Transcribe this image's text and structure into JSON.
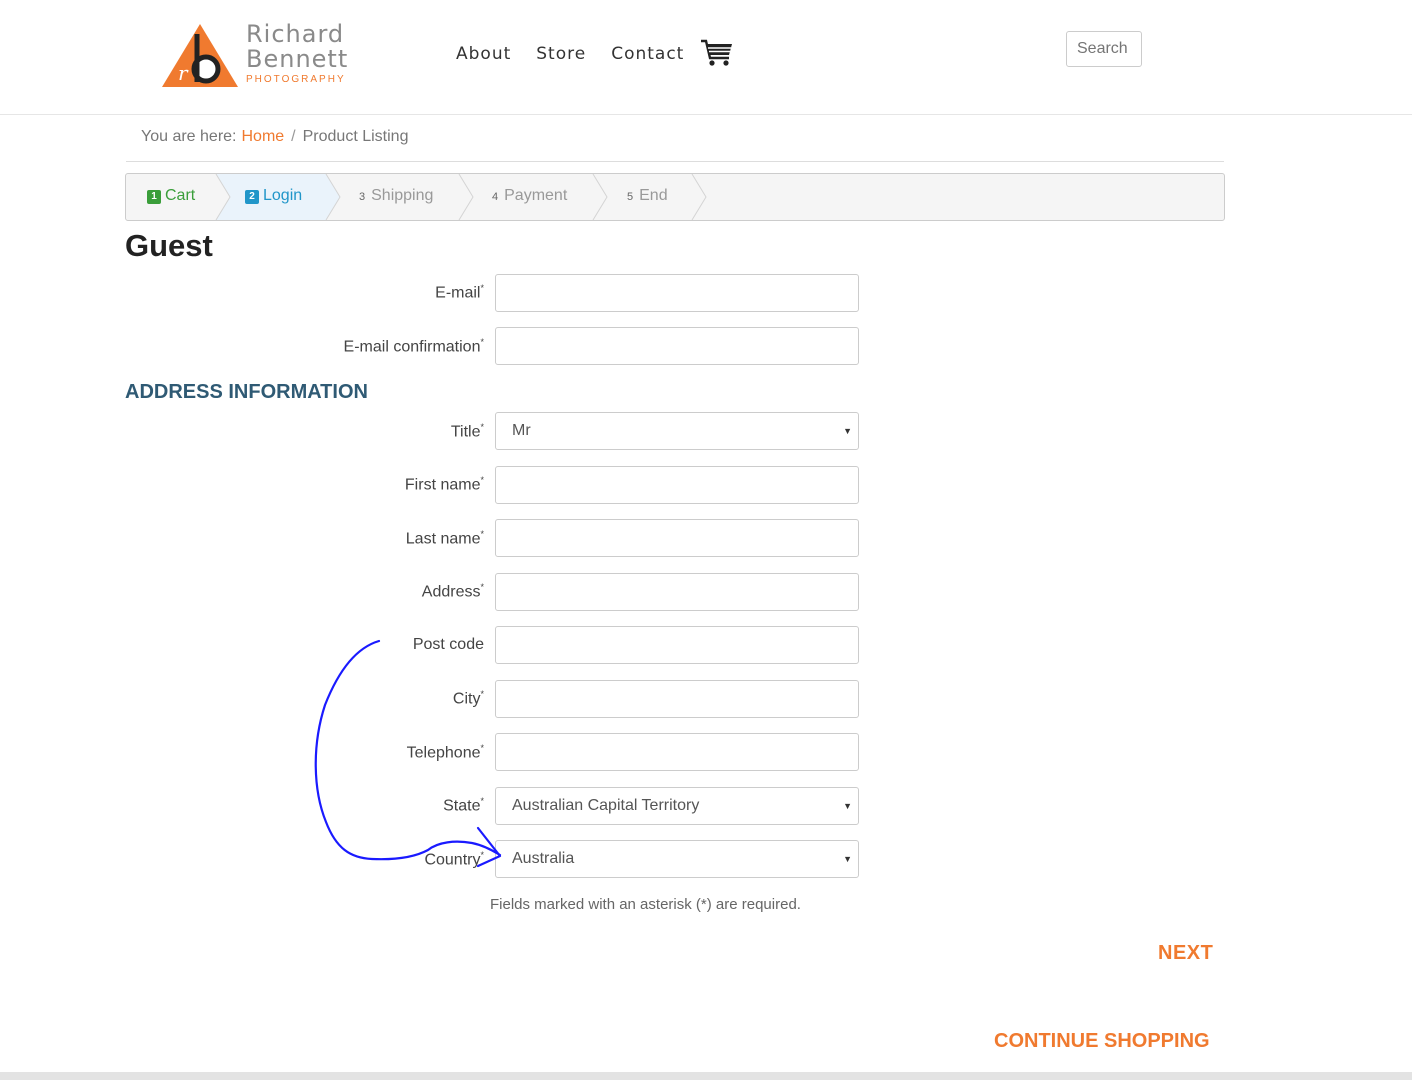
{
  "brand": {
    "line1": "Richard",
    "line2": "Bennett",
    "line3": "PHOTOGRAPHY",
    "accent": "#f07a2f"
  },
  "nav": {
    "items": [
      "About",
      "Store",
      "Contact"
    ],
    "cart_icon": "cart-icon"
  },
  "search": {
    "placeholder": "Search"
  },
  "breadcrumb": {
    "prefix": "You are here:",
    "home": "Home",
    "separator": "/",
    "current": "Product Listing"
  },
  "steps": [
    {
      "num": "1",
      "label": "Cart",
      "state": "done"
    },
    {
      "num": "2",
      "label": "Login",
      "state": "active"
    },
    {
      "num": "3",
      "label": "Shipping",
      "state": "pending"
    },
    {
      "num": "4",
      "label": "Payment",
      "state": "pending"
    },
    {
      "num": "5",
      "label": "End",
      "state": "pending"
    }
  ],
  "page_title": "Guest",
  "form": {
    "email": {
      "label": "E-mail",
      "value": ""
    },
    "email_confirm": {
      "label": "E-mail confirmation",
      "value": ""
    },
    "section_title": "ADDRESS INFORMATION",
    "title": {
      "label": "Title",
      "value": "Mr"
    },
    "first_name": {
      "label": "First name",
      "value": ""
    },
    "last_name": {
      "label": "Last name",
      "value": ""
    },
    "address": {
      "label": "Address",
      "value": ""
    },
    "post_code": {
      "label": "Post code",
      "value": ""
    },
    "city": {
      "label": "City",
      "value": ""
    },
    "telephone": {
      "label": "Telephone",
      "value": ""
    },
    "state": {
      "label": "State",
      "value": "Australian Capital Territory"
    },
    "country": {
      "label": "Country",
      "value": "Australia"
    },
    "required_marker": "*",
    "required_note": "Fields marked with an asterisk (*) are required."
  },
  "actions": {
    "next": "NEXT",
    "continue": "CONTINUE SHOPPING"
  },
  "colors": {
    "accent": "#f07a2f",
    "done": "#3a9e3a",
    "active": "#2196c9",
    "section": "#2f5a74",
    "annotation": "#1a1aff"
  }
}
